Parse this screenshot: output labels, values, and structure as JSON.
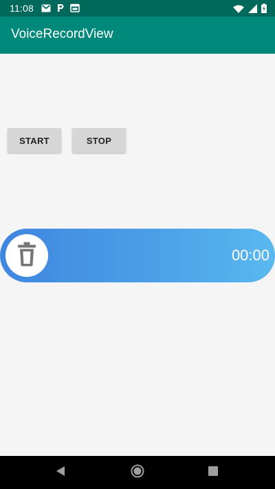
{
  "status_bar": {
    "time": "11:08",
    "left_icons": [
      "gmail-icon",
      "parking-icon",
      "calendar-icon"
    ],
    "right_icons": [
      "wifi-icon",
      "signal-icon",
      "battery-icon"
    ]
  },
  "app_bar": {
    "title": "VoiceRecordView"
  },
  "controls": {
    "start_label": "START",
    "stop_label": "STOP"
  },
  "recorder": {
    "timer": "00:00",
    "delete_icon": "trash-icon"
  },
  "nav_bar": {
    "buttons": [
      "back-icon",
      "home-icon",
      "recents-icon"
    ]
  },
  "colors": {
    "status_bar": "#00695c",
    "app_bar": "#00897b",
    "recorder_gradient_start": "#3f86e0",
    "recorder_gradient_end": "#5ab8ef",
    "trash_icon": "#757575"
  }
}
